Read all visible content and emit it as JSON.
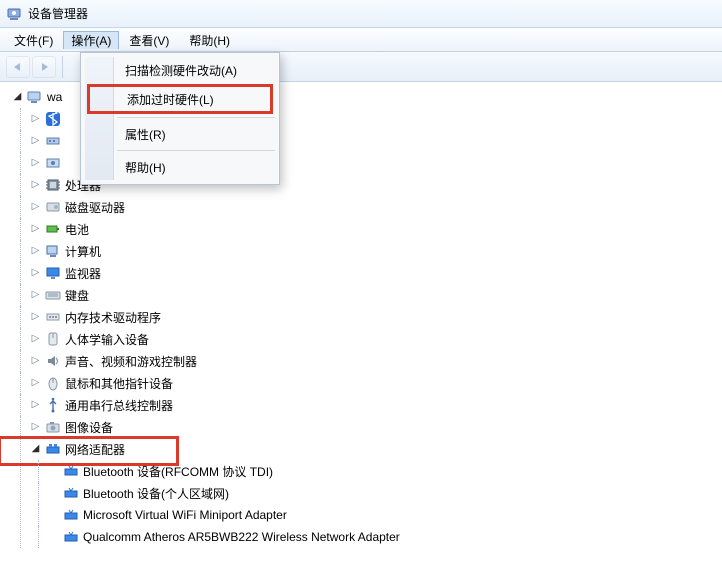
{
  "window": {
    "title": "设备管理器"
  },
  "menubar": {
    "file": "文件(F)",
    "action": "操作(A)",
    "view": "查看(V)",
    "help": "帮助(H)"
  },
  "dropdown": {
    "scan": "扫描检测硬件改动(A)",
    "addLegacy": "添加过时硬件(L)",
    "properties": "属性(R)",
    "help": "帮助(H)"
  },
  "tree": {
    "root": "wa",
    "nodes": {
      "processors": "处理器",
      "diskDrives": "磁盘驱动器",
      "batteries": "电池",
      "computer": "计算机",
      "monitors": "监视器",
      "keyboards": "键盘",
      "memoryTech": "内存技术驱动程序",
      "hid": "人体学输入设备",
      "sound": "声音、视频和游戏控制器",
      "mice": "鼠标和其他指针设备",
      "usb": "通用串行总线控制器",
      "imaging": "图像设备",
      "network": "网络适配器"
    },
    "networkChildren": {
      "bt1": "Bluetooth 设备(RFCOMM 协议 TDI)",
      "bt2": "Bluetooth 设备(个人区域网)",
      "vwifi": "Microsoft Virtual WiFi Miniport Adapter",
      "atheros": "Qualcomm Atheros AR5BWB222 Wireless Network Adapter"
    }
  },
  "colors": {
    "highlight": "#d93a2b"
  }
}
